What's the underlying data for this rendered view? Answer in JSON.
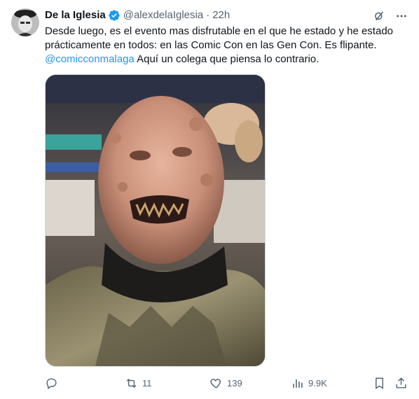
{
  "tweet": {
    "author": {
      "display_name": "De la Iglesia",
      "handle": "@alexdelaIglesia",
      "verified": true
    },
    "separator": "·",
    "timestamp": "22h",
    "text_line1": "Desde luego, es el evento mas disfrutable en el que he estado y he estado prácticamente en todos: en las Comic Con en las Gen Con. Es flipante.",
    "mention": "@comicconmalaga",
    "text_after_mention": " Aquí un colega que piensa lo contrario.",
    "stats": {
      "replies": "",
      "retweets": "11",
      "likes": "139",
      "views": "9.9K"
    }
  },
  "colors": {
    "accent": "#1d9bf0",
    "secondary_text": "#536471"
  },
  "icons": [
    "grok-icon",
    "more-icon",
    "reply-icon",
    "retweet-icon",
    "like-icon",
    "views-icon",
    "bookmark-icon",
    "share-icon"
  ]
}
